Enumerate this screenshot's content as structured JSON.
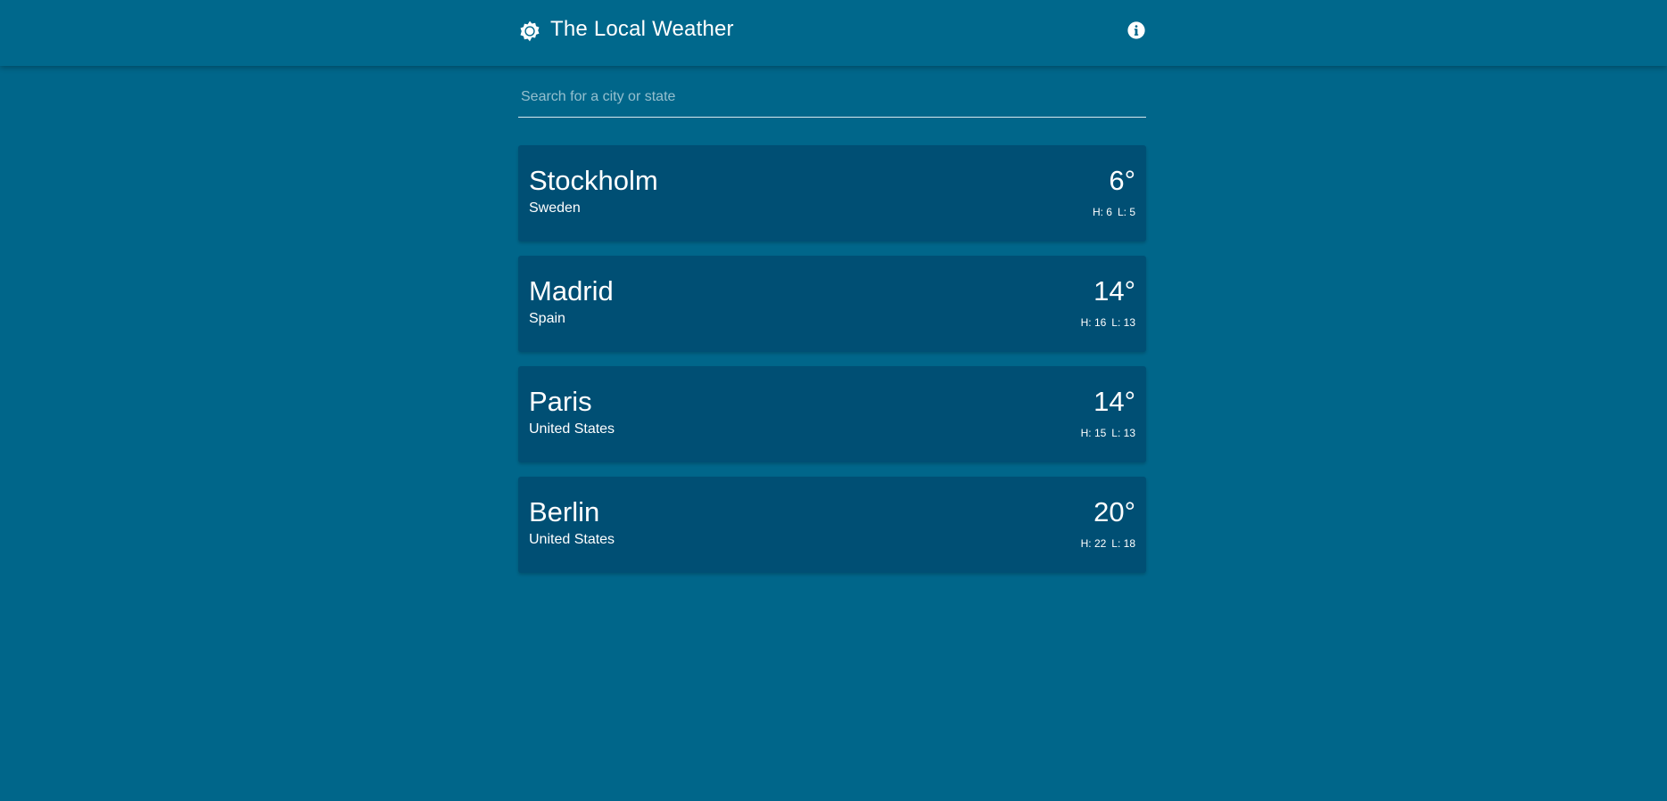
{
  "app": {
    "title": "The Local Weather",
    "logo_icon": "sun-icon",
    "info_icon": "info-icon"
  },
  "search": {
    "placeholder": "Search for a city or state",
    "value": ""
  },
  "cities": [
    {
      "name": "Stockholm",
      "country": "Sweden",
      "temperature": "6°",
      "high": "H: 6",
      "low": "L: 5"
    },
    {
      "name": "Madrid",
      "country": "Spain",
      "temperature": "14°",
      "high": "H: 16",
      "low": "L: 13"
    },
    {
      "name": "Paris",
      "country": "United States",
      "temperature": "14°",
      "high": "H: 15",
      "low": "L: 13"
    },
    {
      "name": "Berlin",
      "country": "United States",
      "temperature": "20°",
      "high": "H: 22",
      "low": "L: 18"
    }
  ],
  "colors": {
    "background": "#00668a",
    "header": "#00688c",
    "card": "#004f74",
    "text": "#ffffff"
  }
}
